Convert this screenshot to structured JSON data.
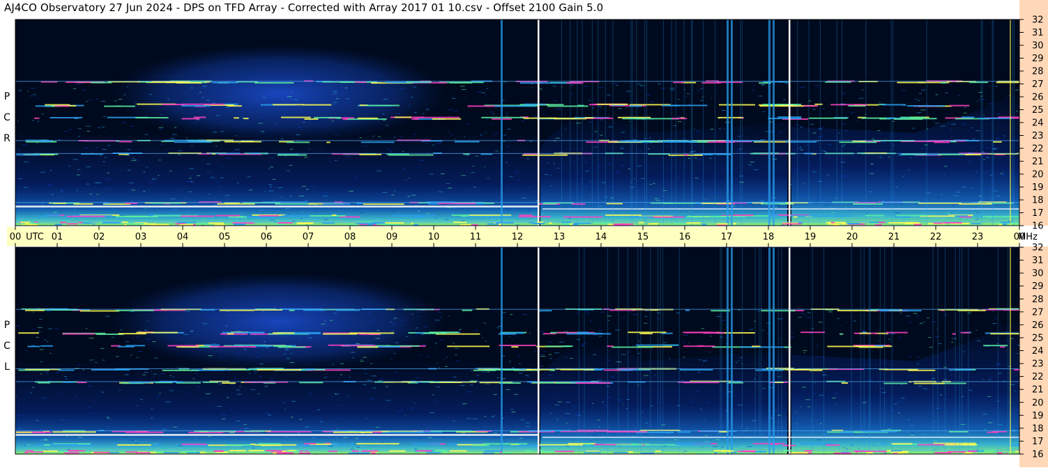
{
  "title": "AJ4CO Observatory  27 Jun 2024  -  DPS on TFD Array  -  Corrected with Array 2017 01 10.csv  -  Offset 2100  Gain 5.0",
  "chart_data": {
    "type": "heatmap",
    "panels": [
      {
        "name": "RCP",
        "label_letters": [
          "P",
          "C",
          "R"
        ]
      },
      {
        "name": "LCP",
        "label_letters": [
          "P",
          "C",
          "L"
        ]
      }
    ],
    "x_axis": {
      "unit_label": "UTC",
      "ticks": [
        "00",
        "01",
        "02",
        "03",
        "04",
        "05",
        "06",
        "07",
        "08",
        "09",
        "10",
        "11",
        "12",
        "13",
        "14",
        "15",
        "16",
        "17",
        "18",
        "19",
        "20",
        "21",
        "22",
        "23",
        "00"
      ],
      "range_hours": [
        0,
        24
      ]
    },
    "y_axis": {
      "unit_label": "MHz",
      "ticks": [
        "32",
        "31",
        "30",
        "29",
        "28",
        "27",
        "26",
        "25",
        "24",
        "23",
        "22",
        "21",
        "20",
        "19",
        "18",
        "17",
        "16"
      ],
      "range_mhz": [
        16,
        32
      ]
    },
    "features": {
      "data_gaps_utc": [
        12.5,
        18.5
      ],
      "broadband_interference_utc": [
        11.6,
        17.0,
        17.1,
        18.0,
        18.1
      ],
      "persistent_bands_mhz": [
        27.2,
        22.6,
        21.6,
        17.8,
        16.8,
        24.4,
        25.4
      ]
    },
    "colors": {
      "background": "#000a1e",
      "low": "#0a3cc8",
      "mid": "#28a0f0",
      "high": "#5cf0a0",
      "peak": "#ffff50",
      "outlier": "#ff40c0",
      "axis_strip": "#ffffc0",
      "freq_strip": "#ffd8b8"
    },
    "grid": "off",
    "legend": "none"
  }
}
